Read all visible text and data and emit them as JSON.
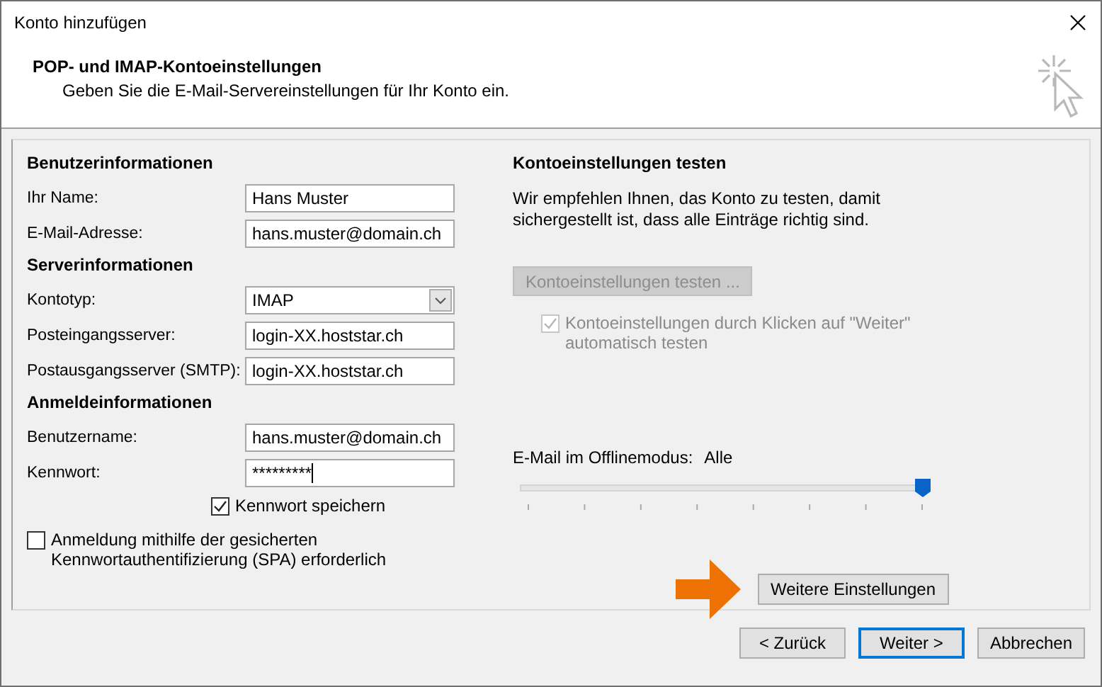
{
  "window": {
    "title": "Konto hinzufügen"
  },
  "header": {
    "title": "POP- und IMAP-Kontoeinstellungen",
    "subtitle": "Geben Sie die E-Mail-Servereinstellungen für Ihr Konto ein."
  },
  "left": {
    "sections": [
      {
        "heading": "Benutzerinformationen",
        "fields": [
          {
            "label": "Ihr Name:",
            "kind": "text",
            "value": "Hans Muster",
            "focused": false
          },
          {
            "label": "E-Mail-Adresse:",
            "kind": "text",
            "value": "hans.muster@domain.ch",
            "focused": false
          }
        ]
      },
      {
        "heading": "Serverinformationen",
        "fields": [
          {
            "label": "Kontotyp:",
            "kind": "dropdown",
            "value": "IMAP"
          },
          {
            "label": "Posteingangsserver:",
            "kind": "text",
            "value": "login-XX.hoststar.ch",
            "focused": false
          },
          {
            "label": "Postausgangsserver (SMTP):",
            "kind": "text",
            "value": "login-XX.hoststar.ch",
            "focused": false
          }
        ]
      },
      {
        "heading": "Anmeldeinformationen",
        "fields": [
          {
            "label": "Benutzername:",
            "kind": "text",
            "value": "hans.muster@domain.ch",
            "focused": false
          },
          {
            "label": "Kennwort:",
            "kind": "text",
            "value": "*********",
            "focused": true
          }
        ]
      }
    ],
    "save_password": {
      "label": "Kennwort speichern",
      "checked": true
    },
    "spa": {
      "label": "Anmeldung mithilfe der gesicherten Kennwortauthentifizierung (SPA) erforderlich",
      "checked": false
    }
  },
  "right": {
    "heading": "Kontoeinstellungen testen",
    "description": "Wir empfehlen Ihnen, das Konto zu testen, damit sichergestellt ist, dass alle Einträge richtig sind.",
    "test_button": {
      "label": "Kontoeinstellungen testen ...",
      "disabled": true
    },
    "auto_test": {
      "label": "Kontoeinstellungen durch Klicken auf \"Weiter\" automatisch testen",
      "checked": true,
      "disabled": true
    },
    "offline": {
      "label": "E-Mail im Offlinemodus:",
      "value": "Alle",
      "level": 1
    },
    "more_button": "Weitere Einstellungen"
  },
  "buttons": [
    {
      "label": "< Zurück",
      "default": false
    },
    {
      "label": "Weiter >",
      "default": true
    },
    {
      "label": "Abbrechen",
      "default": false
    }
  ]
}
